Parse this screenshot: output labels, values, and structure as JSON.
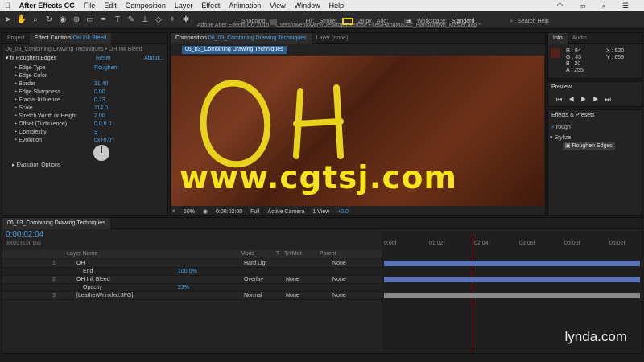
{
  "menubar": {
    "app": "After Effects CC",
    "items": [
      "File",
      "Edit",
      "Composition",
      "Layer",
      "Effect",
      "Animation",
      "View",
      "Window",
      "Help"
    ]
  },
  "window_title": "Adobe After Effects CC 2015 - /Users/owenlowery/Desktop/Exercise Files/HandMade2_HandDrawn_Master.aep *",
  "toolbar": {
    "snapping": "Snapping",
    "fill": "Fill:",
    "stroke": "Stroke:",
    "stroke_px": "28 px",
    "add": "Add:",
    "workspace_label": "Workspace:",
    "workspace": "Standard",
    "search": "Search Help"
  },
  "left_panel": {
    "tab_project": "Project",
    "tab_effect": "Effect Controls",
    "tab_effect_layer": "OH Ink Bleed",
    "crumb": "06_03_Combining Drawing Techniques • OH Ink Bleed",
    "effect_name": "Roughen Edges",
    "reset": "Reset",
    "about": "About...",
    "props": [
      {
        "label": "Edge Type",
        "value": "Roughen"
      },
      {
        "label": "Edge Color",
        "value": ""
      },
      {
        "label": "Border",
        "value": "31.40"
      },
      {
        "label": "Edge Sharpness",
        "value": "0.00"
      },
      {
        "label": "Fractal Influence",
        "value": "0.73"
      },
      {
        "label": "Scale",
        "value": "114.0"
      },
      {
        "label": "Stretch Width or Height",
        "value": "2.00"
      },
      {
        "label": "Offset (Turbulence)",
        "value": "0.0,0.0"
      },
      {
        "label": "Complexity",
        "value": "9"
      },
      {
        "label": "Evolution",
        "value": "0x+0.0°"
      }
    ],
    "evolution_options": "Evolution Options"
  },
  "composition": {
    "tab_prefix": "Composition",
    "tab_name": "06_03_Combining Drawing Techniques",
    "layer_tab": "Layer (none)",
    "breadcrumb": "06_03_Combining Drawing Techniques",
    "text": "OH",
    "watermark": "www.cgtsj.com",
    "controls": {
      "zoom": "50%",
      "time": "0:00:02:00",
      "res": "Full",
      "camera": "Active Camera",
      "views": "1 View",
      "exposure": "+0.0"
    }
  },
  "info": {
    "tab_info": "Info",
    "tab_audio": "Audio",
    "r": "R : 84",
    "g": "G : 45",
    "b": "B : 20",
    "a": "A : 255",
    "x": "X : 520",
    "y": "Y : 658"
  },
  "preview": {
    "title": "Preview"
  },
  "effects_presets": {
    "title": "Effects & Presets",
    "search": "rough",
    "category": "Stylize",
    "item": "Roughen Edges"
  },
  "timeline": {
    "tab": "06_03_Combining Drawing Techniques",
    "time": "0:00:02:04",
    "frames": "00020 (8.00 fps)",
    "headers": [
      "Layer Name",
      "Mode",
      "T",
      "TrkMat",
      "Parent"
    ],
    "ruler": [
      "0:00f",
      "01:02f",
      "02:04f",
      "03:06f",
      "05:00f",
      "06:02f"
    ],
    "layers": [
      {
        "num": "1",
        "name": "OH",
        "mode": "Hard Ligt",
        "trkmat": "",
        "parent": "None"
      },
      {
        "num": "",
        "name": "End",
        "mode": "100.0%",
        "trkmat": "",
        "parent": ""
      },
      {
        "num": "2",
        "name": "OH Ink Bleed",
        "mode": "Overlay",
        "trkmat": "None",
        "parent": "None"
      },
      {
        "num": "",
        "name": "Opacity",
        "mode": "23%",
        "trkmat": "",
        "parent": ""
      },
      {
        "num": "3",
        "name": "[LeatherWrinkled.JPG]",
        "mode": "Normal",
        "trkmat": "None",
        "parent": "None"
      }
    ]
  },
  "brand": "lynda.com"
}
